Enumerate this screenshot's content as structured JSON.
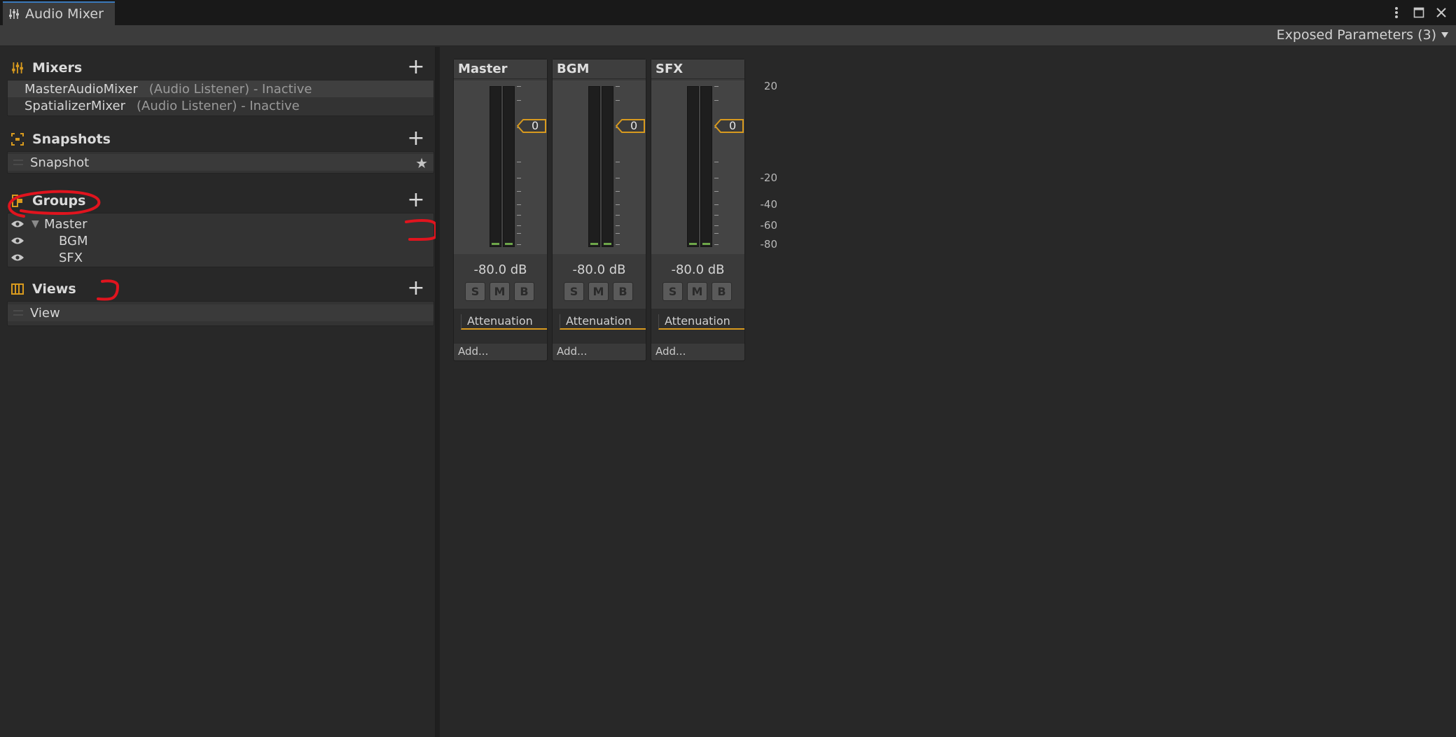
{
  "window": {
    "tab_title": "Audio Mixer",
    "icon": "mixer-sliders-icon"
  },
  "toolbar": {
    "exposed_parameters": "Exposed Parameters (3)"
  },
  "colors": {
    "accent_orange": "#d89a1e",
    "annotation_red": "#e0141e",
    "meter_green": "#6ea64a"
  },
  "mixers": {
    "title": "Mixers",
    "items": [
      {
        "name": "MasterAudioMixer",
        "desc": "(Audio Listener) - Inactive",
        "selected": true
      },
      {
        "name": "SpatializerMixer",
        "desc": "(Audio Listener) - Inactive",
        "selected": false
      }
    ]
  },
  "snapshots": {
    "title": "Snapshots",
    "items": [
      {
        "name": "Snapshot",
        "starred": true
      }
    ]
  },
  "groups": {
    "title": "Groups",
    "items": [
      {
        "name": "Master",
        "expanded": true
      },
      {
        "name": "BGM"
      },
      {
        "name": "SFX"
      }
    ]
  },
  "views": {
    "title": "Views",
    "items": [
      {
        "name": "View"
      }
    ]
  },
  "strips": [
    {
      "name": "Master",
      "db": "-80.0 dB",
      "fader": "0",
      "solo": "S",
      "mute": "M",
      "bypass": "B",
      "effect": "Attenuation",
      "add": "Add..."
    },
    {
      "name": "BGM",
      "db": "-80.0 dB",
      "fader": "0",
      "solo": "S",
      "mute": "M",
      "bypass": "B",
      "effect": "Attenuation",
      "add": "Add..."
    },
    {
      "name": "SFX",
      "db": "-80.0 dB",
      "fader": "0",
      "solo": "S",
      "mute": "M",
      "bypass": "B",
      "effect": "Attenuation",
      "add": "Add..."
    }
  ],
  "scale_labels": [
    "20",
    "-20",
    "-40",
    "-60",
    "-80"
  ]
}
